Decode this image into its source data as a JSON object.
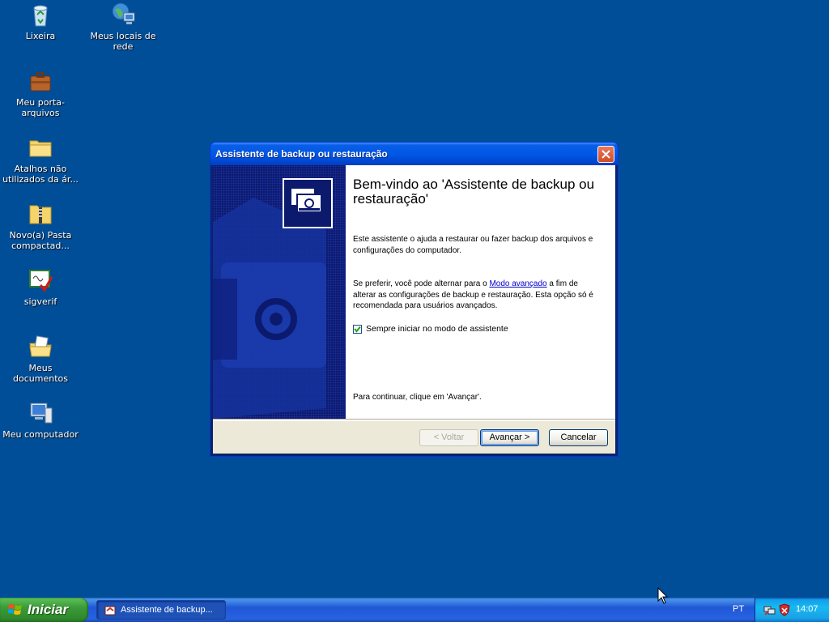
{
  "desktop": {
    "icons": [
      {
        "label": "Lixeira",
        "icon": "recycle-bin-icon"
      },
      {
        "label": "Meus locais de rede",
        "icon": "network-places-icon"
      },
      {
        "label": "Meu porta-arquivos",
        "icon": "briefcase-icon"
      },
      {
        "label": "Atalhos não utilizados da ár...",
        "icon": "folder-icon"
      },
      {
        "label": "Novo(a) Pasta compactad...",
        "icon": "zip-folder-icon"
      },
      {
        "label": "sigverif",
        "icon": "sigverif-icon"
      },
      {
        "label": "Meus documentos",
        "icon": "my-documents-icon"
      },
      {
        "label": "Meu computador",
        "icon": "my-computer-icon"
      }
    ]
  },
  "dialog": {
    "title": "Assistente de backup ou restauração",
    "heading": "Bem-vindo ao 'Assistente de backup ou restauração'",
    "intro": "Este assistente o ajuda a restaurar ou fazer backup dos arquivos e configurações do computador.",
    "pref_before": "Se preferir, você pode alternar para o ",
    "pref_link": "Modo avançado",
    "pref_after": " a fim de alterar as configurações de backup e restauração. Esta opção só é recomendada para usuários avançados.",
    "checkbox_label": "Sempre iniciar no modo de assistente",
    "checkbox_checked": true,
    "continue_text": "Para continuar, clique em 'Avançar'.",
    "buttons": {
      "back": "< Voltar",
      "next": "Avançar >",
      "cancel": "Cancelar"
    }
  },
  "taskbar": {
    "start_label": "Iniciar",
    "task_label": "Assistente de backup...",
    "language": "PT",
    "clock": "14:07"
  },
  "colors": {
    "desktop": "#004e98",
    "titlebar": "#0058e6",
    "start": "#3c9a39"
  }
}
